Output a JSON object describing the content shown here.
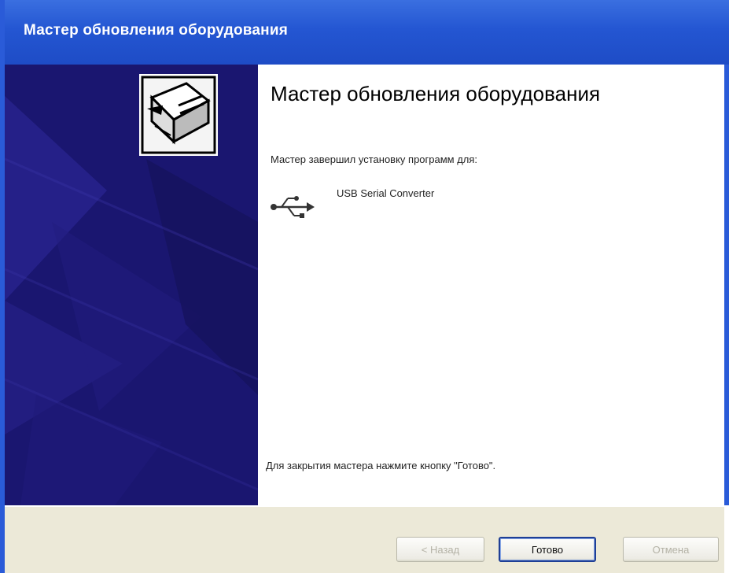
{
  "window": {
    "title": "Мастер обновления оборудования"
  },
  "content": {
    "heading": "Мастер обновления оборудования",
    "subtitle": "Мастер завершил установку программ для:",
    "device_name": "USB Serial Converter",
    "finish_text": "Для закрытия мастера нажмите кнопку \"Готово\"."
  },
  "buttons": {
    "back_label": "< Назад",
    "finish_label": "Готово",
    "cancel_label": "Отмена"
  },
  "icons": {
    "wizard": "hardware-wizard-icon",
    "device": "usb-icon"
  },
  "colors": {
    "titlebar": "#2456d2",
    "banner": "#1a1670",
    "footer": "#ece9d8"
  }
}
